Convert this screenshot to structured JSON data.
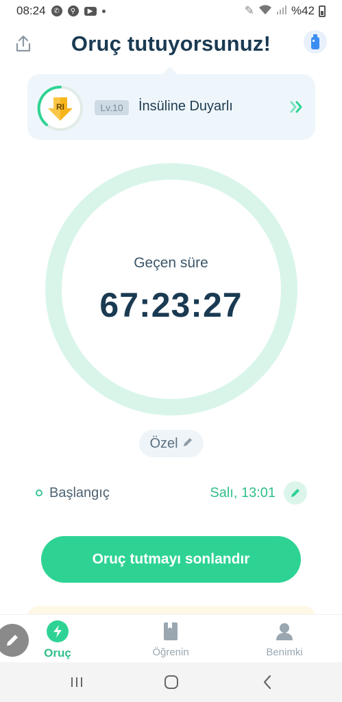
{
  "status_bar": {
    "time": "08:24",
    "battery_pct": "%42"
  },
  "header": {
    "title": "Oruç tutuyorsunuz!"
  },
  "level_card": {
    "badge_text": "RI",
    "level_label": "Lv.10",
    "level_name": "İnsüline Duyarlı"
  },
  "timer": {
    "elapsed_label": "Geçen süre",
    "elapsed_time": "67:23:27"
  },
  "plan": {
    "label": "Özel"
  },
  "start": {
    "label": "Başlangıç",
    "value": "Salı, 13:01"
  },
  "actions": {
    "end_fast_label": "Oruç tutmayı sonlandır"
  },
  "bottom_nav": {
    "items": [
      {
        "label": "Oruç",
        "icon": "bolt-icon",
        "active": true
      },
      {
        "label": "Öğrenin",
        "icon": "book-icon",
        "active": false
      },
      {
        "label": "Benimki",
        "icon": "person-icon",
        "active": false
      }
    ]
  },
  "colors": {
    "accent": "#2ed394",
    "accent_text": "#2fbf88",
    "title": "#1a3a52",
    "ring": "#d9f5ea",
    "card_bg": "#eef6fb"
  }
}
